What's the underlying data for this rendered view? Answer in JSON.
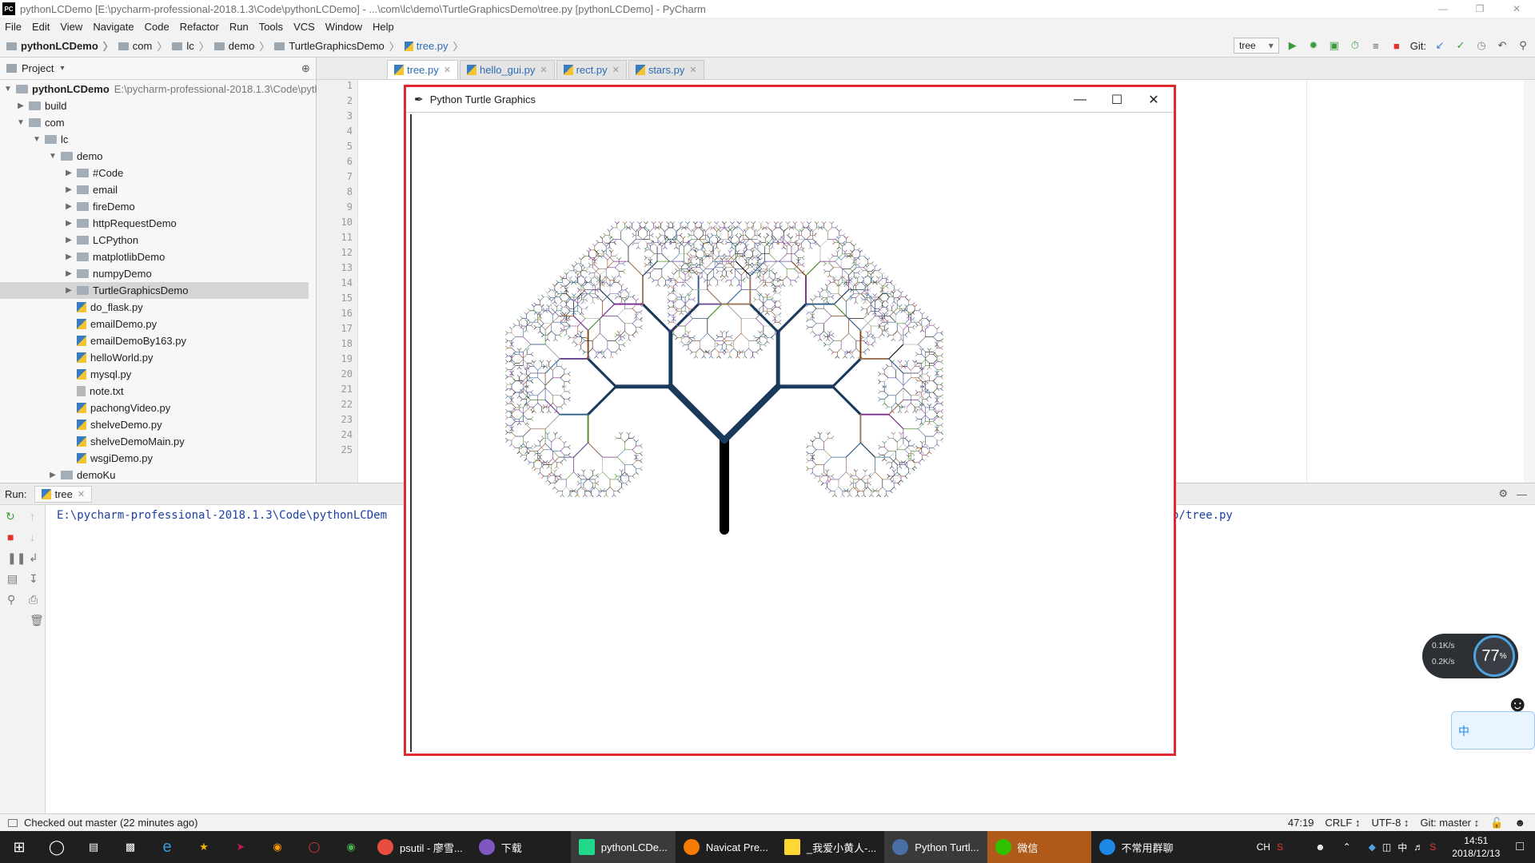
{
  "window": {
    "title": "pythonLCDemo [E:\\pycharm-professional-2018.1.3\\Code\\pythonLCDemo] - ...\\com\\lc\\demo\\TurtleGraphicsDemo\\tree.py [pythonLCDemo] - PyCharm",
    "app_icon": "PC"
  },
  "menu": [
    "File",
    "Edit",
    "View",
    "Navigate",
    "Code",
    "Refactor",
    "Run",
    "Tools",
    "VCS",
    "Window",
    "Help"
  ],
  "breadcrumb": [
    "pythonLCDemo",
    "com",
    "lc",
    "demo",
    "TurtleGraphicsDemo",
    "tree.py"
  ],
  "toolbar": {
    "run_config": "tree",
    "git_label": "Git:"
  },
  "project_panel": {
    "title": "Project",
    "root_label": "pythonLCDemo",
    "root_path": "E:\\pycharm-professional-2018.1.3\\Code\\pythonLCDemo",
    "items": [
      {
        "label": "build"
      },
      {
        "label": "com"
      },
      {
        "label": "lc"
      },
      {
        "label": "demo"
      },
      {
        "label": "#Code"
      },
      {
        "label": "email"
      },
      {
        "label": "fireDemo"
      },
      {
        "label": "httpRequestDemo"
      },
      {
        "label": "LCPython"
      },
      {
        "label": "matplotlibDemo"
      },
      {
        "label": "numpyDemo"
      },
      {
        "label": "TurtleGraphicsDemo"
      },
      {
        "label": "do_flask.py"
      },
      {
        "label": "emailDemo.py"
      },
      {
        "label": "emailDemoBy163.py"
      },
      {
        "label": "helloWorld.py"
      },
      {
        "label": "mysql.py"
      },
      {
        "label": "note.txt"
      },
      {
        "label": "pachongVideo.py"
      },
      {
        "label": "shelveDemo.py"
      },
      {
        "label": "shelveDemoMain.py"
      },
      {
        "label": "wsgiDemo.py"
      },
      {
        "label": "demoKu"
      }
    ]
  },
  "editor_tabs": [
    "tree.py",
    "hello_gui.py",
    "rect.py",
    "stars.py"
  ],
  "line_numbers": [
    "1",
    "2",
    "3",
    "4",
    "5",
    "6",
    "7",
    "8",
    "9",
    "10",
    "11",
    "12",
    "13",
    "14",
    "15",
    "16",
    "17",
    "18",
    "19",
    "20",
    "21",
    "22",
    "23",
    "24",
    "25"
  ],
  "run_panel": {
    "label": "Run:",
    "tab": "tree",
    "console_start": "E:\\pycharm-professional-2018.1.3\\Code\\pythonLCDem",
    "console_end": "o/tree.py"
  },
  "status": {
    "message": "Checked out master (22 minutes ago)",
    "position": "47:19",
    "line_sep": "CRLF ↕",
    "encoding": "UTF-8 ↕",
    "git": "Git: master ↕"
  },
  "turtle_window": {
    "title": "Python Turtle Graphics"
  },
  "net_widget": {
    "up": "0.1K/s",
    "down": "0.2K/s",
    "percent": "77",
    "percent_unit": "%"
  },
  "ime": {
    "label": "中"
  },
  "taskbar": {
    "items": [
      {
        "label": "psutil - 廖雪..."
      },
      {
        "label": "下载"
      },
      {
        "label": "pythonLCDe..."
      },
      {
        "label": "Navicat Pre..."
      },
      {
        "label": "_我爱小黄人-..."
      },
      {
        "label": "Python Turtl..."
      },
      {
        "label": "微信"
      },
      {
        "label": "不常用群聊"
      }
    ],
    "lang": "CH",
    "ime_char": "中",
    "time": "14:51",
    "date": "2018/12/13"
  }
}
